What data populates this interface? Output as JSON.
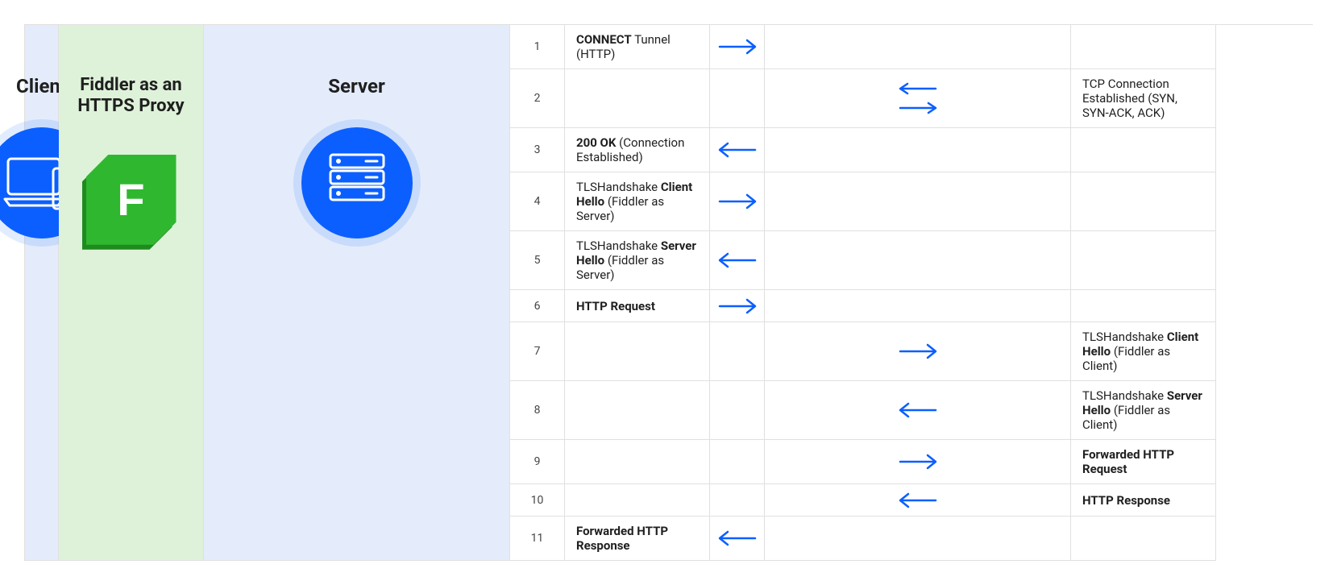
{
  "columns": {
    "client_title": "Client",
    "fiddler_title": "Fiddler as an HTTPS Proxy",
    "server_title": "Server",
    "fiddler_letter": "F"
  },
  "rows": [
    {
      "n": "1",
      "client_msg_bold": "CONNECT",
      "client_msg_rest": " Tunnel (HTTP)",
      "client_arrow": "right",
      "server_arrow": "",
      "server_msg_pre": "",
      "server_msg_bold": "",
      "server_msg_rest": ""
    },
    {
      "n": "2",
      "client_msg_bold": "",
      "client_msg_rest": "",
      "client_arrow": "",
      "server_arrow": "bidir",
      "server_msg_pre": "TCP Connection Established (SYN, SYN-ACK, ACK)",
      "server_msg_bold": "",
      "server_msg_rest": ""
    },
    {
      "n": "3",
      "client_msg_bold": "200 OK",
      "client_msg_rest": " (Connection Established)",
      "client_arrow": "left",
      "server_arrow": "",
      "server_msg_pre": "",
      "server_msg_bold": "",
      "server_msg_rest": ""
    },
    {
      "n": "4",
      "client_msg_pre": "TLSHandshake ",
      "client_msg_bold": "Client Hello",
      "client_msg_rest": " (Fiddler as Server)",
      "client_arrow": "right",
      "server_arrow": "",
      "server_msg_pre": "",
      "server_msg_bold": "",
      "server_msg_rest": ""
    },
    {
      "n": "5",
      "client_msg_pre": "TLSHandshake ",
      "client_msg_bold": "Server Hello",
      "client_msg_rest": " (Fiddler as Server)",
      "client_arrow": "left",
      "server_arrow": "",
      "server_msg_pre": "",
      "server_msg_bold": "",
      "server_msg_rest": ""
    },
    {
      "n": "6",
      "client_msg_bold": "HTTP Request",
      "client_msg_rest": "",
      "client_arrow": "right",
      "server_arrow": "",
      "server_msg_pre": "",
      "server_msg_bold": "",
      "server_msg_rest": ""
    },
    {
      "n": "7",
      "client_msg_bold": "",
      "client_msg_rest": "",
      "client_arrow": "",
      "server_arrow": "right",
      "server_msg_pre": "TLSHandshake ",
      "server_msg_bold": "Client Hello",
      "server_msg_rest": " (Fiddler as Client)"
    },
    {
      "n": "8",
      "client_msg_bold": "",
      "client_msg_rest": "",
      "client_arrow": "",
      "server_arrow": "left",
      "server_msg_pre": "TLSHandshake ",
      "server_msg_bold": "Server Hello",
      "server_msg_rest": " (Fiddler as Client)"
    },
    {
      "n": "9",
      "client_msg_bold": "",
      "client_msg_rest": "",
      "client_arrow": "",
      "server_arrow": "right",
      "server_msg_pre": "",
      "server_msg_bold": "Forwarded HTTP Request",
      "server_msg_rest": ""
    },
    {
      "n": "10",
      "client_msg_bold": "",
      "client_msg_rest": "",
      "client_arrow": "",
      "server_arrow": "left",
      "server_msg_pre": "",
      "server_msg_bold": "HTTP Response",
      "server_msg_rest": ""
    },
    {
      "n": "11",
      "client_msg_bold": "Forwarded HTTP Response",
      "client_msg_rest": "",
      "client_arrow": "left",
      "server_arrow": "",
      "server_msg_pre": "",
      "server_msg_bold": "",
      "server_msg_rest": ""
    }
  ]
}
